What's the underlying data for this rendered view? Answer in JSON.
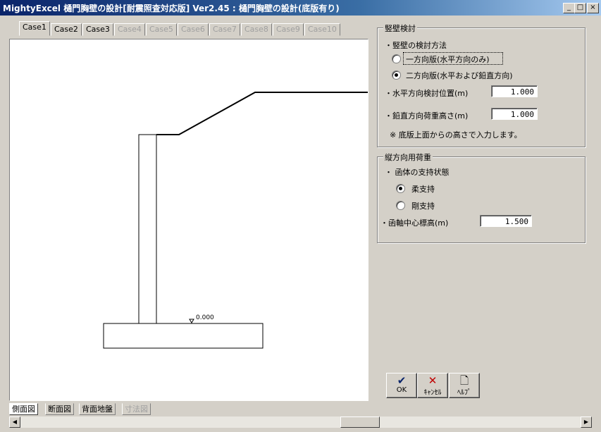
{
  "window": {
    "title": "MightyExcel 樋門胸壁の設計[耐震照査対応版] Ver2.45 : 樋門胸壁の設計(底版有り)",
    "minimize": "_",
    "maximize": "□",
    "close": "×"
  },
  "case_tabs": [
    {
      "label": "Case1",
      "enabled": true
    },
    {
      "label": "Case2",
      "enabled": true
    },
    {
      "label": "Case3",
      "enabled": true
    },
    {
      "label": "Case4",
      "enabled": false
    },
    {
      "label": "Case5",
      "enabled": false
    },
    {
      "label": "Case6",
      "enabled": false
    },
    {
      "label": "Case7",
      "enabled": false
    },
    {
      "label": "Case8",
      "enabled": false
    },
    {
      "label": "Case9",
      "enabled": false
    },
    {
      "label": "Case10",
      "enabled": false
    }
  ],
  "drawing": {
    "level_label": "0.000"
  },
  "wall_check": {
    "title": "竪壁検討",
    "method_label": "・竪壁の検討方法",
    "options": [
      {
        "label": "一方向版(水平方向のみ)",
        "selected": false
      },
      {
        "label": "二方向版(水平および鉛直方向)",
        "selected": true
      }
    ],
    "horizontal_pos_label": "・水平方向検討位置(m)",
    "horizontal_pos_value": "1.000",
    "vertical_load_label": "・鉛直方向荷重高さ(m)",
    "vertical_load_value": "1.000",
    "note": "※ 底版上面からの高さで入力します。"
  },
  "longitudinal_load": {
    "title": "縦方向用荷重",
    "support_label": "・ 函体の支持状態",
    "options": [
      {
        "label": "柔支持",
        "selected": true
      },
      {
        "label": "剛支持",
        "selected": false
      }
    ],
    "center_label": "・函軸中心標高(m)",
    "center_value": "1.500"
  },
  "buttons": {
    "ok": "OK",
    "cancel": "ｷｬﾝｾﾙ",
    "help": "ﾍﾙﾌﾟ"
  },
  "bottom_tabs": [
    {
      "label": "側面図",
      "enabled": true,
      "selected": true
    },
    {
      "label": "断面図",
      "enabled": true,
      "selected": false
    },
    {
      "label": "背面地盤",
      "enabled": true,
      "selected": false
    },
    {
      "label": "寸法図",
      "enabled": false,
      "selected": false
    }
  ],
  "colors": {
    "title_start": "#0a246a",
    "title_end": "#a6caf0",
    "ok_check": "#0a246a",
    "cancel_x": "#c00000"
  }
}
